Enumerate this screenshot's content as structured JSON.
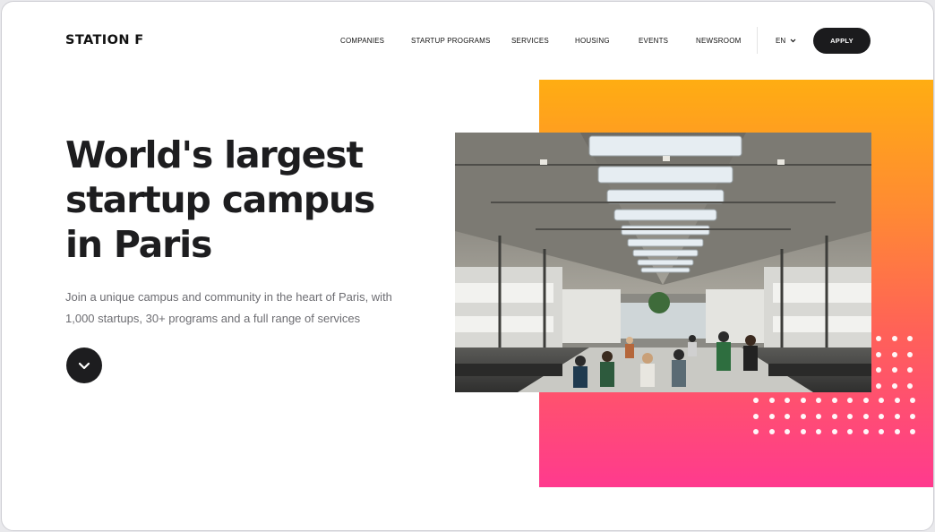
{
  "brand": {
    "logo_text": "STATION F"
  },
  "nav": {
    "items": [
      {
        "label": "COMPANIES",
        "id": "companies"
      },
      {
        "label": "STARTUP PROGRAMS",
        "id": "startup-programs"
      },
      {
        "label": "SERVICES",
        "id": "services"
      },
      {
        "label": "HOUSING",
        "id": "housing"
      },
      {
        "label": "EVENTS",
        "id": "events"
      },
      {
        "label": "NEWSROOM",
        "id": "newsroom"
      }
    ],
    "language": "EN",
    "apply_label": "APPLY"
  },
  "hero": {
    "title": "World's largest startup campus in Paris",
    "subtitle": "Join a unique campus and community in the heart of Paris, with 1,000 startups, 30+ programs and a full range of services",
    "scroll_icon": "chevron-down-icon"
  },
  "colors": {
    "gradient_top": "#ffad12",
    "gradient_bottom": "#ff3a8e",
    "dark": "#1d1d1f"
  }
}
